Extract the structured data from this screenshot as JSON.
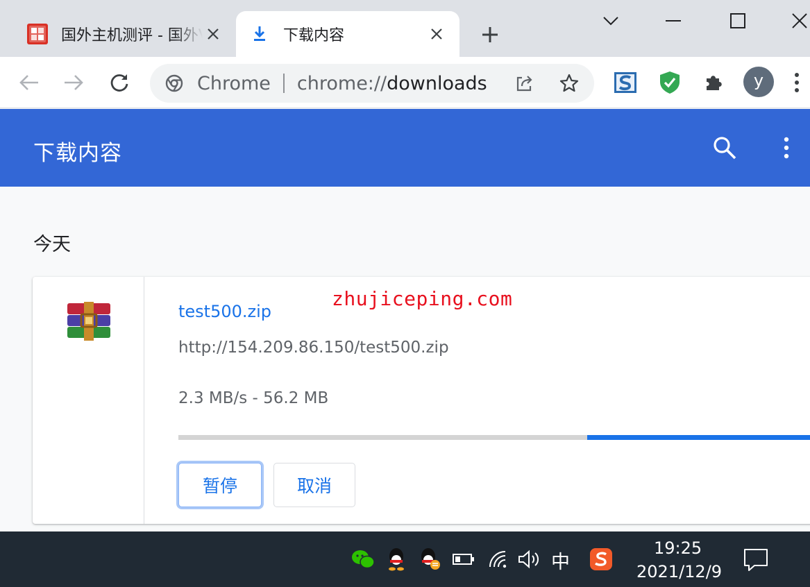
{
  "tabs": [
    {
      "title": "国外主机测评 - 国外VPS",
      "active": false,
      "favicon": "zhujiceping-favicon"
    },
    {
      "title": "下载内容",
      "active": true,
      "favicon": "download-icon"
    }
  ],
  "omnibox": {
    "scheme_label": "Chrome",
    "url_prefix": "chrome://",
    "url_host": "downloads"
  },
  "extensions": [
    "s-extension-icon",
    "shield-extension-icon",
    "puzzle-icon"
  ],
  "profile": {
    "initial": "y"
  },
  "downloads_page": {
    "title": "下载内容",
    "date_group": "今天",
    "item": {
      "file_name": "test500.zip",
      "url": "http://154.209.86.150/test500.zip",
      "status": "2.3 MB/s - 56.2 MB",
      "progress": 0.36,
      "pause_label": "暂停",
      "cancel_label": "取消"
    }
  },
  "watermark": "zhujiceping.com",
  "taskbar": {
    "ime": "中",
    "time": "19:25",
    "date": "2021/12/9"
  },
  "colors": {
    "accent": "#1a73e8",
    "header": "#3367d6",
    "taskbar": "#202a34"
  }
}
